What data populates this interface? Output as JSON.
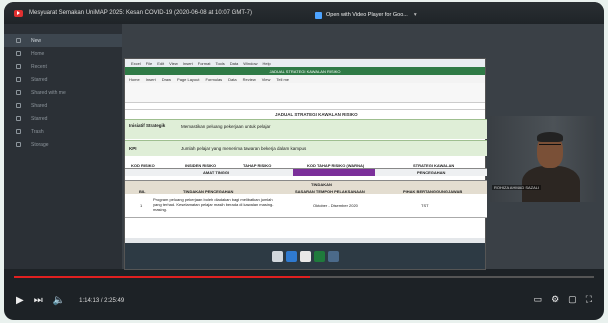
{
  "player": {
    "title": "Mesyuarat Semakan UniMAP 2025: Kesan COVID-19 (2020-06-08 at 10:07 GMT-7)",
    "open_with": "Open with Video Player for Goo...",
    "time": "1:14:13 / 2:25:49",
    "progress_fraction": 0.51,
    "accent": "#e02020"
  },
  "zoom_sidebar": {
    "items": [
      "New",
      "Home",
      "Recent",
      "Starred",
      "Shared with me",
      "Shared",
      "Starred",
      "Trash",
      "Storage"
    ]
  },
  "spreadsheet": {
    "menu": [
      "Excel",
      "File",
      "Edit",
      "View",
      "Insert",
      "Format",
      "Tools",
      "Data",
      "Window",
      "Help"
    ],
    "window_title": "JADUAL STRATEGI KAWALAN RISIKO",
    "ribbon_tabs": [
      "Home",
      "Insert",
      "Draw",
      "Page Layout",
      "Formulas",
      "Data",
      "Review",
      "View",
      "Tell me"
    ],
    "sheet_title": "JADUAL STRATEGI KAWALAN RISIKO",
    "inisiatif_label": "Inisiatif Strategik",
    "inisiatif_value": "Memastikan peluang pekerjaan untuk pelajar",
    "kpi_label": "KPI",
    "kpi_value": "Jumlah pelajar yang menerima tawaran bekerja dalam kampus",
    "headers": {
      "kod": "KOD RISIKO",
      "insiden": "INSIDEN RISIKO",
      "tahap": "TAHAP RISIKO",
      "kod_tahap": "KOD TAHAP RISIKO (WARNA)",
      "strategi": "STRATEGI KAWALAN"
    },
    "values": {
      "tahap": "AMAT TINGGI",
      "strategi": "PENCEGAHAN"
    },
    "table_headers": {
      "bil": "BIL",
      "tindakan": "TINDAKAN PENCEGAHAN",
      "sasaran": "SASARAN TEMPOH PELAKSANAAN",
      "sasaran_top": "TINDAKAN",
      "pihak": "PIHAK BERTANGGUNGJAWAB"
    },
    "row": {
      "bil": "1",
      "tindakan": "Program peluang pekerjaan boleh diadakan bagi melibatkan jumlah yang terhad. Keselamatan pelajar masih berada di kawalan masing-masing.",
      "sasaran": "Oktober - Disember 2020",
      "pihak": "TST"
    },
    "purple_color": "#7b2f9a"
  },
  "webcam": {
    "name": "ROHIZA AHMAD SAZALI"
  }
}
